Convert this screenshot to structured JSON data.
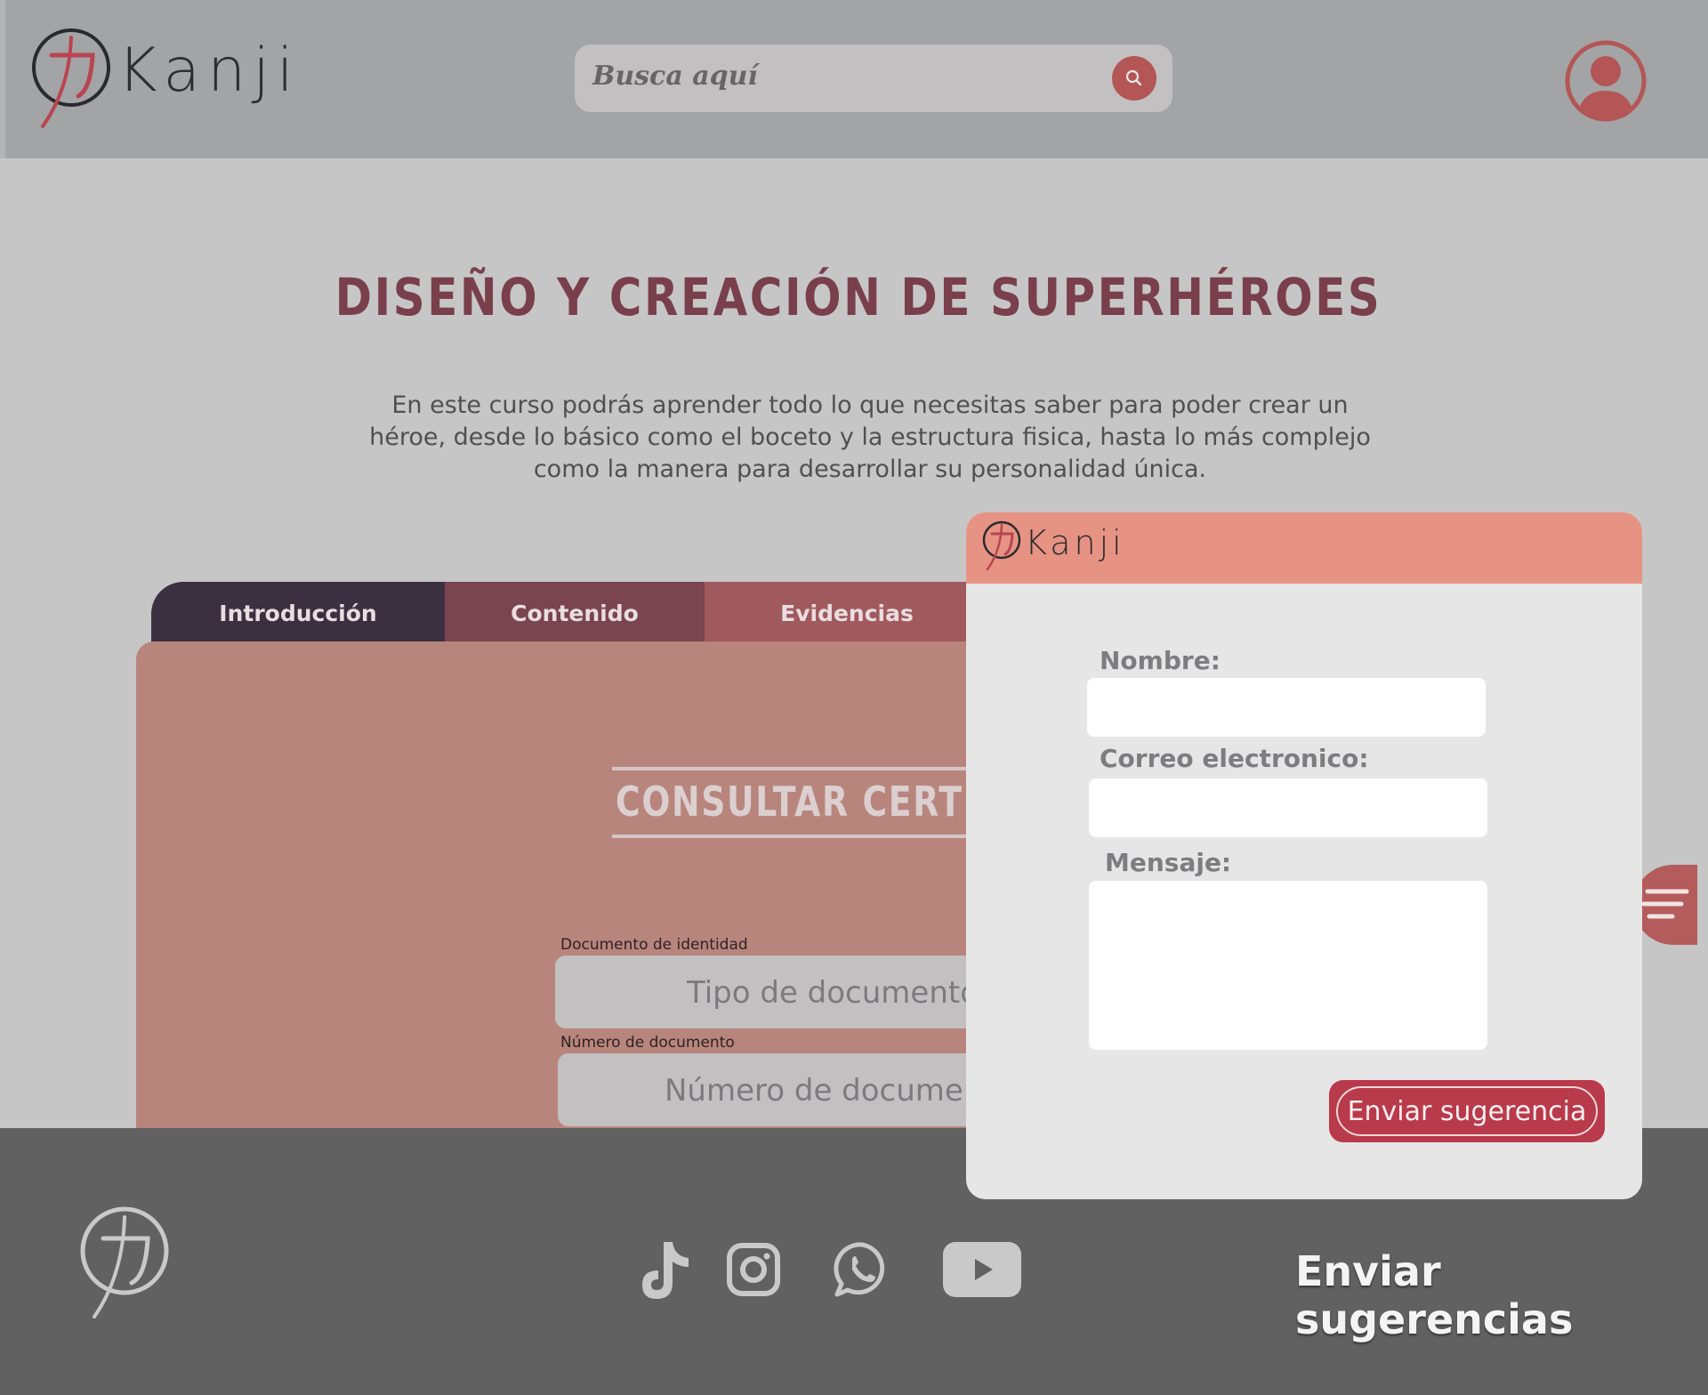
{
  "header": {
    "brand": "Kanji",
    "search_placeholder": "Busca aquí"
  },
  "course": {
    "title": "DISEÑO Y CREACIÓN DE SUPERHÉROES",
    "description": "En este curso podrás aprender todo lo que necesitas saber para poder crear un héroe, desde lo básico como el boceto y la estructura fisica, hasta lo más complejo como la manera para desarrollar su personalidad única."
  },
  "tabs": [
    {
      "label": "Introducción"
    },
    {
      "label": "Contenido"
    },
    {
      "label": "Evidencias"
    }
  ],
  "certificate": {
    "title": "CONSULTAR CERTIFICA",
    "doc_label": "Documento de identidad",
    "doc_placeholder": "Tipo de documento",
    "num_label": "Número de documento",
    "num_placeholder": "Número de document"
  },
  "modal": {
    "brand": "Kanji",
    "name_label": "Nombre:",
    "email_label": "Correo electronico:",
    "message_label": "Mensaje:",
    "submit_label": "Enviar sugerencia"
  },
  "footer": {
    "suggestions_link": "Enviar sugerencias"
  },
  "colors": {
    "accent": "#b45656",
    "header_bg": "#a3a4a6",
    "panel_bg": "#b8857c",
    "modal_header": "#e69384",
    "footer_bg": "#616161",
    "title": "#7a3f4c"
  },
  "icons": [
    "kanji-logo-icon",
    "search-icon",
    "user-icon",
    "menu-icon",
    "tiktok-icon",
    "instagram-icon",
    "whatsapp-icon",
    "youtube-icon"
  ]
}
